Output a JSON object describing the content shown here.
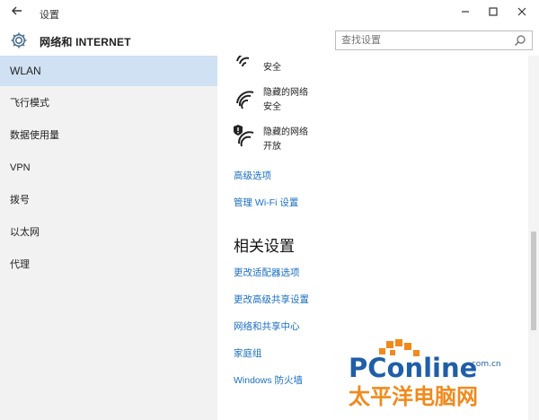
{
  "window": {
    "title": "设置",
    "back_icon": "back-arrow-icon",
    "minimize_icon": "minimize-icon",
    "maximize_icon": "maximize-icon",
    "close_icon": "close-icon"
  },
  "header": {
    "page_title": "网络和 INTERNET",
    "search_placeholder": "查找设置",
    "settings_icon": "gear-icon",
    "search_icon": "search-icon"
  },
  "sidebar": {
    "items": [
      {
        "label": "WLAN",
        "active": true
      },
      {
        "label": "飞行模式"
      },
      {
        "label": "数据使用量"
      },
      {
        "label": "VPN"
      },
      {
        "label": "拨号"
      },
      {
        "label": "以太网"
      },
      {
        "label": "代理"
      }
    ]
  },
  "main": {
    "networks": [
      {
        "ssid": "",
        "status": "安全",
        "icon": "wifi-icon"
      },
      {
        "ssid": "隐藏的网络",
        "status": "安全",
        "icon": "wifi-icon"
      },
      {
        "ssid": "隐藏的网络",
        "status": "开放",
        "icon": "wifi-warning-icon"
      }
    ],
    "links": [
      "高级选项",
      "管理 Wi-Fi 设置"
    ],
    "related_title": "相关设置",
    "related_links": [
      "更改适配器选项",
      "更改高级共享设置",
      "网络和共享中心",
      "家庭组",
      "Windows 防火墙"
    ]
  },
  "watermark": {
    "brand": "PConline",
    "domain": ".com.cn",
    "cn_name": "太平洋电脑网"
  },
  "colors": {
    "accent": "#1a6fc2",
    "sidebar_bg": "#f2f2f2",
    "active_bg": "#cfe1f2",
    "watermark_orange": "#f08a1d",
    "watermark_blue": "#1f5ea8"
  }
}
